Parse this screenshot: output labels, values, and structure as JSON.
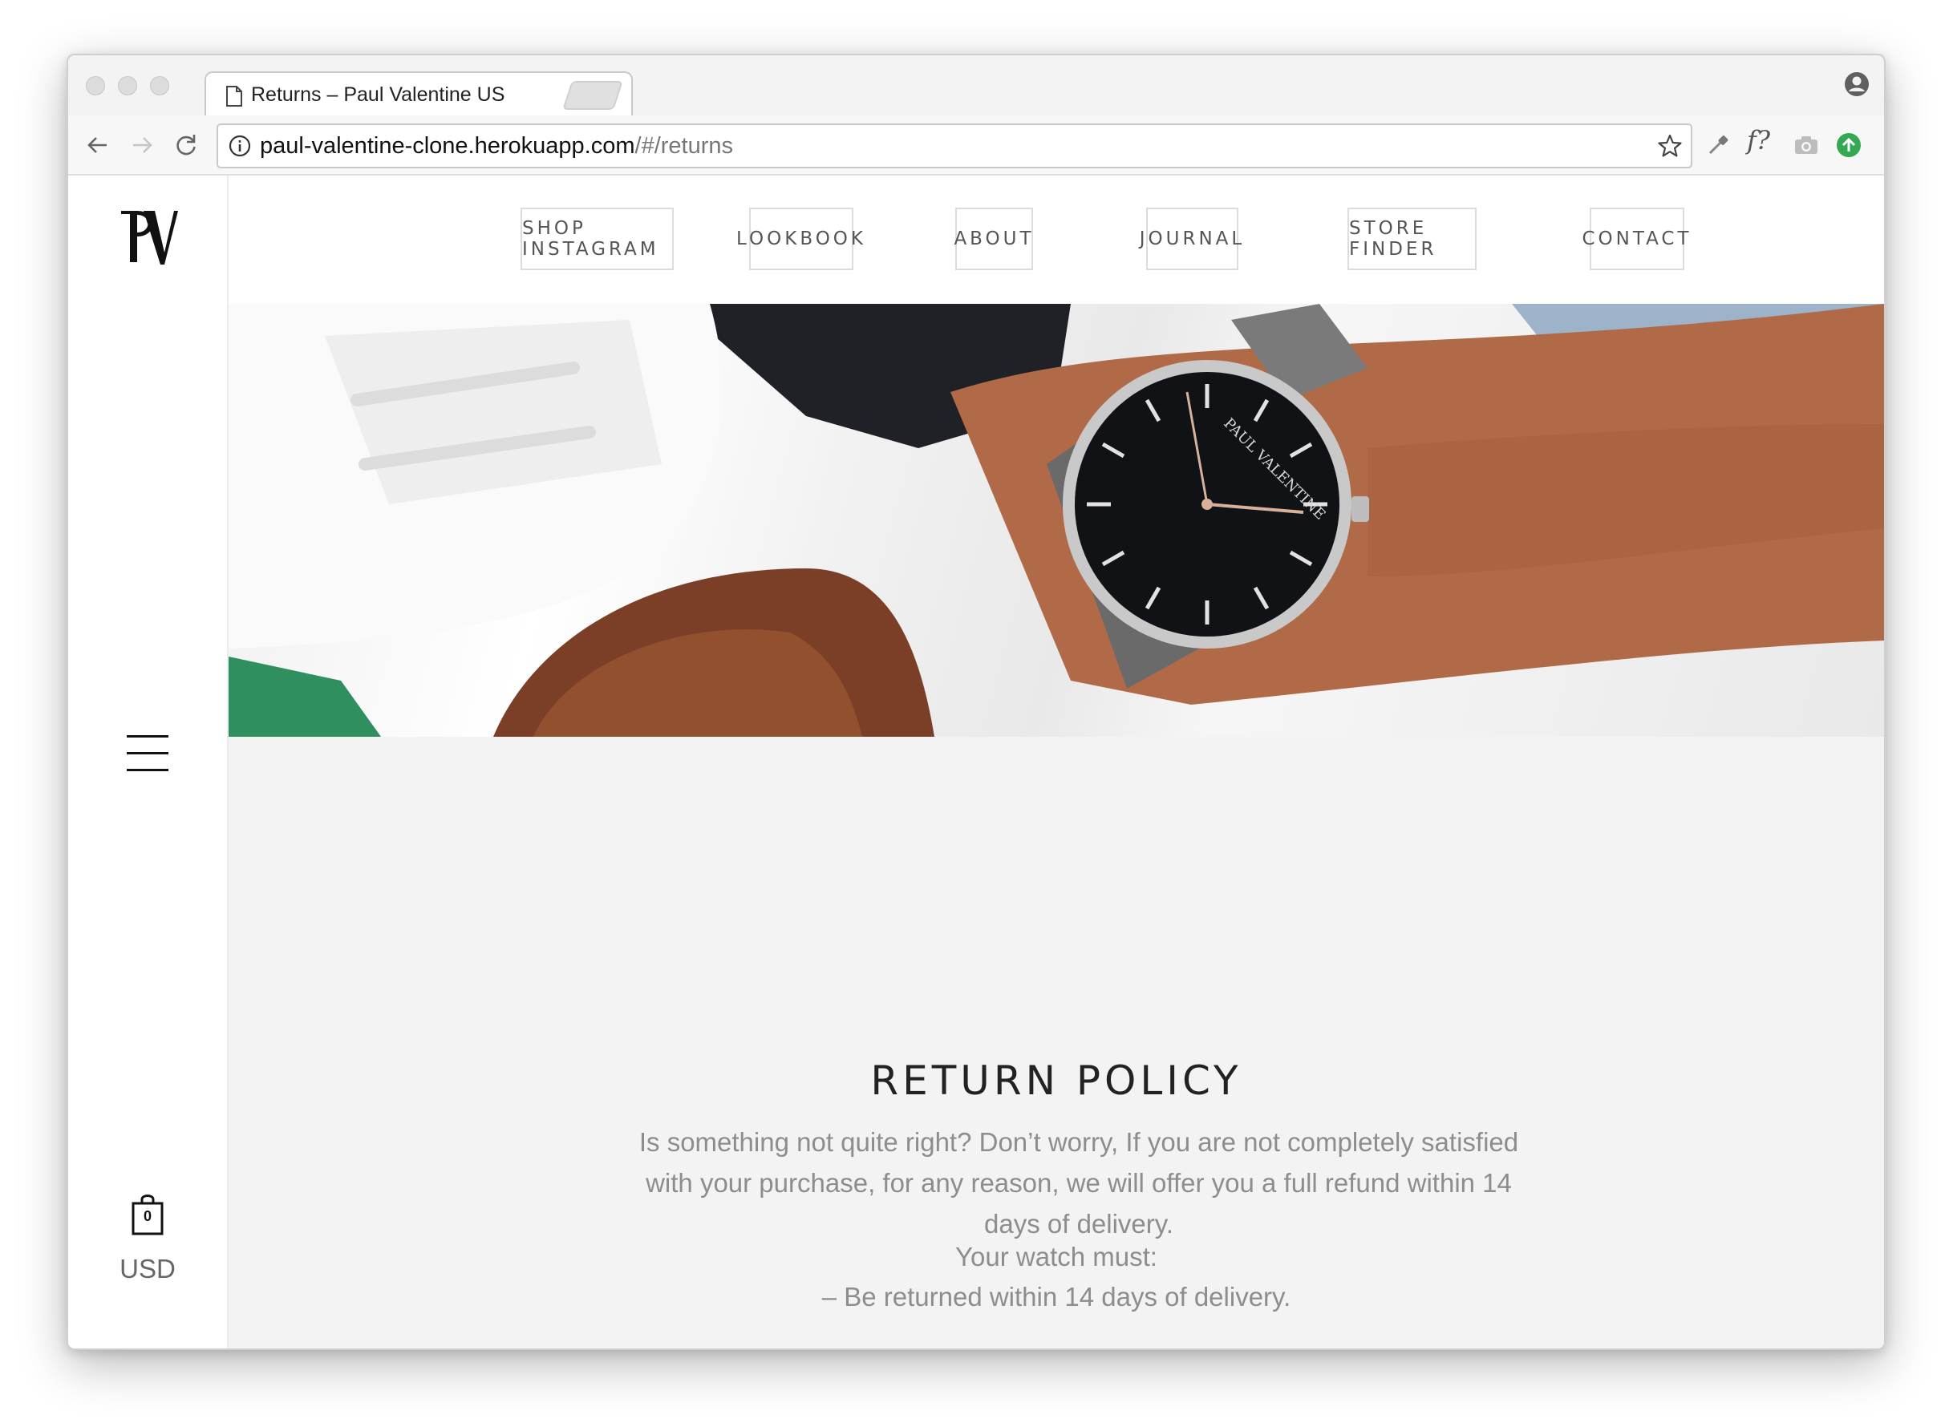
{
  "browser": {
    "tab_title": "Returns – Paul Valentine US",
    "tab_close": "×",
    "url_host": "paul-valentine-clone.herokuapp.com",
    "url_path": "/#/returns",
    "extension_f_label": "f?",
    "extension_colors": {
      "upload": "#34a853"
    }
  },
  "sidebar": {
    "cart_count": "0",
    "currency": "USD"
  },
  "nav": {
    "items": [
      "SHOP INSTAGRAM",
      "LOOKBOOK",
      "ABOUT",
      "JOURNAL",
      "STORE FINDER",
      "CONTACT"
    ]
  },
  "hero": {
    "dial_text": "PAUL VALENTINE"
  },
  "content": {
    "title": "RETURN POLICY",
    "intro": "Is something not quite right? Don’t worry, If you are not completely satisfied with your purchase, for any reason, we will offer you a full refund within 14 days of delivery.",
    "requirements_title": "Your watch must:",
    "requirements": [
      "– Be returned within 14 days of delivery."
    ]
  }
}
